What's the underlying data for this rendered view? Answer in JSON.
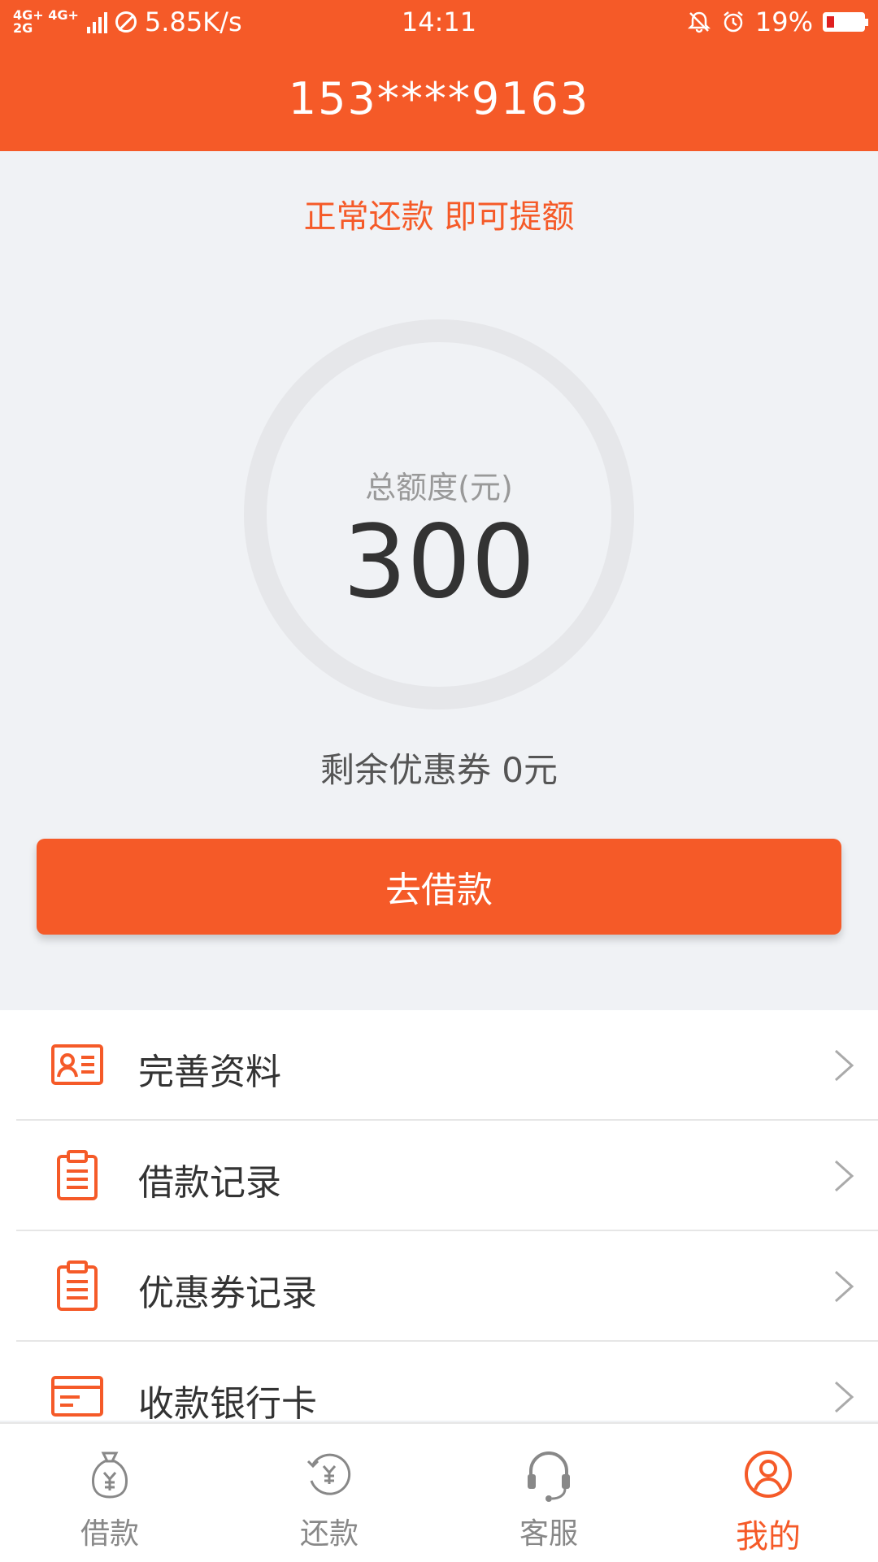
{
  "status_bar": {
    "network_top": "4G+ 4G+",
    "network_bottom": "2G",
    "speed": "5.85K/s",
    "time": "14:11",
    "battery": "19%"
  },
  "header": {
    "title": "153****9163"
  },
  "promo_text": "正常还款 即可提额",
  "credit": {
    "label": "总额度(元)",
    "amount": "300"
  },
  "coupon_text": "剩余优惠券 0元",
  "borrow_button": "去借款",
  "menu": [
    {
      "label": "完善资料",
      "icon": "id-card-icon"
    },
    {
      "label": "借款记录",
      "icon": "clipboard-icon"
    },
    {
      "label": "优惠券记录",
      "icon": "clipboard-icon"
    },
    {
      "label": "收款银行卡",
      "icon": "bank-card-icon"
    }
  ],
  "tabs": [
    {
      "label": "借款",
      "icon": "money-bag-icon",
      "active": false
    },
    {
      "label": "还款",
      "icon": "repay-icon",
      "active": false
    },
    {
      "label": "客服",
      "icon": "headset-icon",
      "active": false
    },
    {
      "label": "我的",
      "icon": "user-icon",
      "active": true
    }
  ],
  "colors": {
    "accent": "#f55a28",
    "background": "#f0f2f5",
    "inactive": "#888888"
  }
}
